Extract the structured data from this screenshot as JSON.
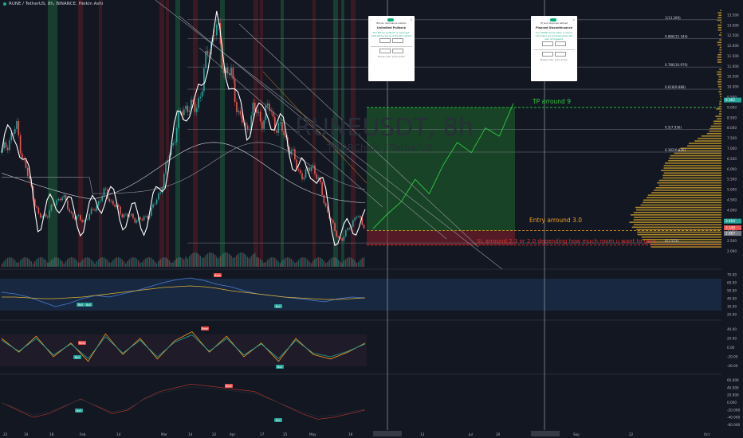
{
  "header": {
    "title": "RUNE / TetherUS, 8h, BINANCE, Heikin Ashi",
    "watermark_symbol": "RUNEUSDT, 8h",
    "watermark_name": "THORChain / TetherUS"
  },
  "colors": {
    "background": "#131722",
    "bull": "#26a69a",
    "bear": "#ef5350",
    "entry_line": "#f0a020",
    "tp_line": "#2ecc40",
    "sl_text": "#e03030",
    "volume_profile": "#c49a2a",
    "fib_line": "#787b86"
  },
  "annotations": {
    "tp": "TP arround 9",
    "entry": "Entry arround 3.0",
    "sl": "SL arround 2.3 or 2.0 depending how much room u want to give"
  },
  "fib_levels": [
    {
      "label": "1(13.269)",
      "value": 13.269
    },
    {
      "label": "0.886(12.344)",
      "value": 12.344
    },
    {
      "label": "0.786(10.970)",
      "value": 10.97
    },
    {
      "label": "0.618(9.888)",
      "value": 9.888
    },
    {
      "label": "0.5(7.936)",
      "value": 7.936
    },
    {
      "label": "0.382(6.826)",
      "value": 6.826
    },
    {
      "label": "0(1.523)",
      "value": 2.4
    }
  ],
  "cards": [
    {
      "title": "Unlimited Pullback",
      "subtitle": "Bitcoin dominance sudden",
      "body": "The Bitcoin pullback is imminent. ALTs will be set up if the ALT market",
      "footer": "Please note: price action"
    },
    {
      "title": "Planned Discontinuance",
      "subtitle": "TP and Stop-loss defined",
      "body": "Your SMART trend setup is active; reminders are provided when the plan is triggered.",
      "footer": "Please note: price action"
    }
  ],
  "price_badges": [
    {
      "label": "3.464",
      "value": 3.464,
      "color": "#26a69a"
    },
    {
      "label": "3.140",
      "value": 3.14,
      "color": "#ef5350"
    },
    {
      "label": "2.867",
      "value": 2.867,
      "color": "#787b86"
    },
    {
      "label": "9.362",
      "value": 9.362,
      "color": "#26a69a"
    }
  ],
  "chart_data": {
    "type": "line",
    "x_tick_labels": [
      "22",
      "10",
      "18",
      "Feb",
      "14",
      "Mar",
      "14",
      "22",
      "Apr",
      "17",
      "25",
      "May",
      "16",
      "6",
      "13",
      "Jul",
      "20",
      "15",
      "Sep",
      "22",
      "Oct"
    ],
    "y_ticks": [
      13.5,
      13.0,
      12.5,
      12.0,
      11.5,
      11.0,
      10.5,
      10.0,
      9.5,
      9.0,
      8.5,
      8.0,
      7.5,
      7.0,
      6.5,
      6.0,
      5.5,
      5.0,
      4.5,
      4.0,
      3.5,
      3.0,
      2.5,
      2.0
    ],
    "ylim": [
      1.9,
      14.0
    ],
    "price_path": [
      6.8,
      7.5,
      8.0,
      6.2,
      5.0,
      3.6,
      3.8,
      4.2,
      4.8,
      4.0,
      3.6,
      3.5,
      3.8,
      4.4,
      4.9,
      4.3,
      3.9,
      3.7,
      3.6,
      3.5,
      3.9,
      4.5,
      5.8,
      7.2,
      8.5,
      9.2,
      8.8,
      9.9,
      12.0,
      13.0,
      11.0,
      10.5,
      8.8,
      7.8,
      9.0,
      8.3,
      9.0,
      8.2,
      7.8,
      7.0,
      6.0,
      5.6,
      6.3,
      5.2,
      4.0,
      3.0,
      2.5,
      3.2,
      3.7,
      3.3
    ],
    "projection_path": [
      3.1,
      3.8,
      4.4,
      5.5,
      4.8,
      6.2,
      7.3,
      6.8,
      8.0,
      7.6,
      9.2
    ],
    "entry": 3.0,
    "take_profit": 9.0,
    "stop_loss": 2.3,
    "osc1_ticks": [
      70,
      60,
      50,
      40,
      30,
      20
    ],
    "osc1_ylim": [
      15,
      75
    ],
    "osc1": [
      48,
      46,
      42,
      36,
      30,
      34,
      40,
      44,
      42,
      46,
      50,
      55,
      60,
      64,
      66,
      63,
      58,
      55,
      50,
      46,
      44,
      42,
      40,
      38,
      36,
      40,
      42,
      41
    ],
    "osc1_signal": [
      42,
      42,
      41,
      40,
      40,
      41,
      42,
      44,
      46,
      48,
      50,
      52,
      54,
      55,
      56,
      55,
      53,
      50,
      48,
      46,
      44,
      42,
      41,
      40,
      39,
      39,
      40,
      41
    ],
    "osc1_badges": [
      "Bull",
      "Bull",
      "Bear",
      "Bull"
    ],
    "osc2_ticks": [
      40.0,
      20.0,
      0.0,
      -20.0,
      -40.0
    ],
    "osc2_ylim": [
      -55,
      55
    ],
    "osc2": [
      20,
      -10,
      25,
      -20,
      10,
      -30,
      30,
      -15,
      20,
      -25,
      15,
      35,
      -10,
      25,
      -20,
      10,
      -30,
      20,
      -15,
      -25,
      -10,
      10
    ],
    "osc2_badges": [
      "Bear",
      "Bull",
      "Bear",
      "Bull"
    ],
    "osc3_ticks": [
      60.0,
      40.0,
      20.0,
      0.0,
      -20.0,
      -40.0,
      -60.0
    ],
    "osc3_ylim": [
      -70,
      70
    ],
    "osc3": [
      0,
      -20,
      -40,
      -30,
      -10,
      10,
      -10,
      -30,
      -20,
      10,
      30,
      40,
      50,
      45,
      40,
      35,
      30,
      10,
      -10,
      -30,
      -45,
      -40,
      -30,
      -20
    ],
    "osc3_badges": [
      "Bull",
      "Bear",
      "Bull"
    ]
  }
}
